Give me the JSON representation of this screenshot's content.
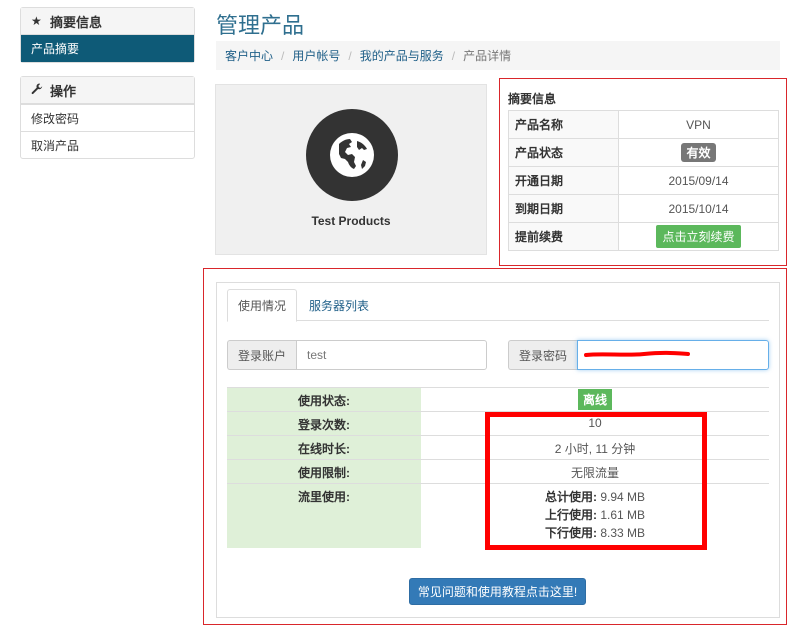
{
  "sidebar": {
    "summary_panel": {
      "title": "摘要信息",
      "icon": "star-icon",
      "items": [
        "产品摘要"
      ]
    },
    "actions_panel": {
      "title": "操作",
      "icon": "wrench-icon",
      "items": [
        "修改密码",
        "取消产品"
      ]
    }
  },
  "header": {
    "title": "管理产品",
    "breadcrumb": [
      "客户中心",
      "用户帐号",
      "我的产品与服务",
      "产品详情"
    ]
  },
  "product": {
    "name": "Test Products",
    "icon": "globe-icon"
  },
  "summary": {
    "title": "摘要信息",
    "rows": [
      {
        "label": "产品名称",
        "value": "VPN"
      },
      {
        "label": "产品状态",
        "value": "有效"
      },
      {
        "label": "开通日期",
        "value": "2015/09/14"
      },
      {
        "label": "到期日期",
        "value": "2015/10/14"
      },
      {
        "label": "提前续费",
        "value": "点击立刻续费"
      }
    ]
  },
  "usage": {
    "tabs": [
      "使用情况",
      "服务器列表"
    ],
    "account_label": "登录账户",
    "account_value": "test",
    "password_label": "登录密码",
    "stats": [
      {
        "label": "使用状态:",
        "value": "离线"
      },
      {
        "label": "登录次数:",
        "value": "10"
      },
      {
        "label": "在线时长:",
        "value": "2 小时, 11 分钟"
      },
      {
        "label": "使用限制:",
        "value": "无限流量"
      },
      {
        "label": "流里使用:"
      }
    ],
    "flow": [
      {
        "label": "总计使用:",
        "value": "9.94 MB"
      },
      {
        "label": "上行使用:",
        "value": "1.61 MB"
      },
      {
        "label": "下行使用:",
        "value": "8.33 MB"
      }
    ],
    "faq_button": "常见问题和使用教程点击这里!"
  },
  "colors": {
    "primary": "#337ab7",
    "success": "#5cb85c",
    "sidebar_active": "#0e5a77",
    "annotation_red": "#ff0000"
  }
}
